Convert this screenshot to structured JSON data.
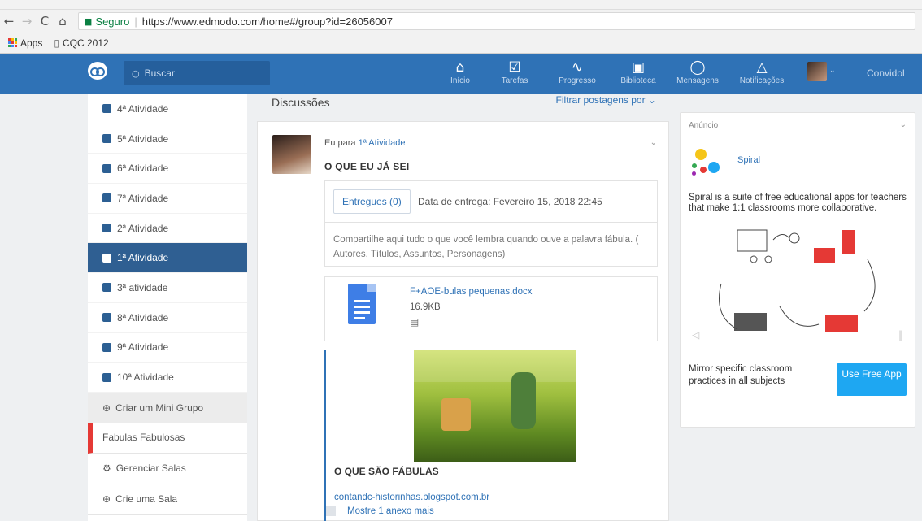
{
  "browser": {
    "back": "←",
    "forward": "→",
    "reload": "C",
    "home": "⌂",
    "secure_label": "Seguro",
    "url": "https://www.edmodo.com/home#/group?id=26056007",
    "bookmarks": [
      {
        "label": "Apps"
      },
      {
        "label": "CQC 2012"
      }
    ]
  },
  "topnav": {
    "search_placeholder": "Buscar",
    "items": [
      {
        "label": "Início",
        "icon": "home-icon",
        "glyph": "⌂"
      },
      {
        "label": "Tarefas",
        "icon": "assignments-icon",
        "glyph": "☑"
      },
      {
        "label": "Progresso",
        "icon": "progress-icon",
        "glyph": "∿"
      },
      {
        "label": "Biblioteca",
        "icon": "library-icon",
        "glyph": "▣"
      },
      {
        "label": "Mensagens",
        "icon": "messages-icon",
        "glyph": "◯"
      },
      {
        "label": "Notificações",
        "icon": "notifications-icon",
        "glyph": "△"
      }
    ],
    "user_label": "Convidol",
    "brand_color": "#2f72b6"
  },
  "sidebar": {
    "groups": [
      {
        "label": "4ª Atividade",
        "active": false
      },
      {
        "label": "5ª Atividade",
        "active": false
      },
      {
        "label": "6ª Atividade",
        "active": false
      },
      {
        "label": "7ª Atividade",
        "active": false
      },
      {
        "label": "2ª Atividade",
        "active": false
      },
      {
        "label": "1ª Atividade",
        "active": true
      },
      {
        "label": "3ª atividade",
        "active": false
      },
      {
        "label": "8ª Atividade",
        "active": false
      },
      {
        "label": "9ª Atividade",
        "active": false
      },
      {
        "label": "10ª Atividade",
        "active": false
      }
    ],
    "create_mini_group": "Criar um Mini Grupo",
    "class_name": "Fabulas Fabulosas",
    "manage_classes": "Gerenciar Salas",
    "create_class": "Crie uma Sala"
  },
  "main": {
    "discussions_title": "Discussões",
    "filter_label": "Filtrar postagens por ⌄",
    "post": {
      "meta_prefix": "Eu para",
      "meta_target": "1ª Atividade",
      "title": "O QUE EU JÁ SEI",
      "submitted_label": "Entregues (0)",
      "due_label": "Data de entrega: Fevereiro 15, 2018 22:45",
      "description": "Compartilhe aqui tudo o que você lembra quando ouve a palavra fábula. ( Autores, Títulos, Assuntos, Personagens)",
      "file_name": "F+AOE-bulas pequenas.docx",
      "file_size": "16.9KB",
      "link_title": "O QUE SÃO FÁBULAS",
      "link_url": "contandc-historinhas.blogspot.com.br",
      "more_attachments": "Mostre 1 anexo mais"
    }
  },
  "ad": {
    "label": "Anúncio",
    "brand": "Spiral",
    "description": "Spiral is a suite of free educational apps for teachers that make 1:1 classrooms more collaborative.",
    "footer_text": "Mirror specific classroom practices in all subjects",
    "cta": "Use Free App",
    "cta_color": "#1ea7f2"
  }
}
